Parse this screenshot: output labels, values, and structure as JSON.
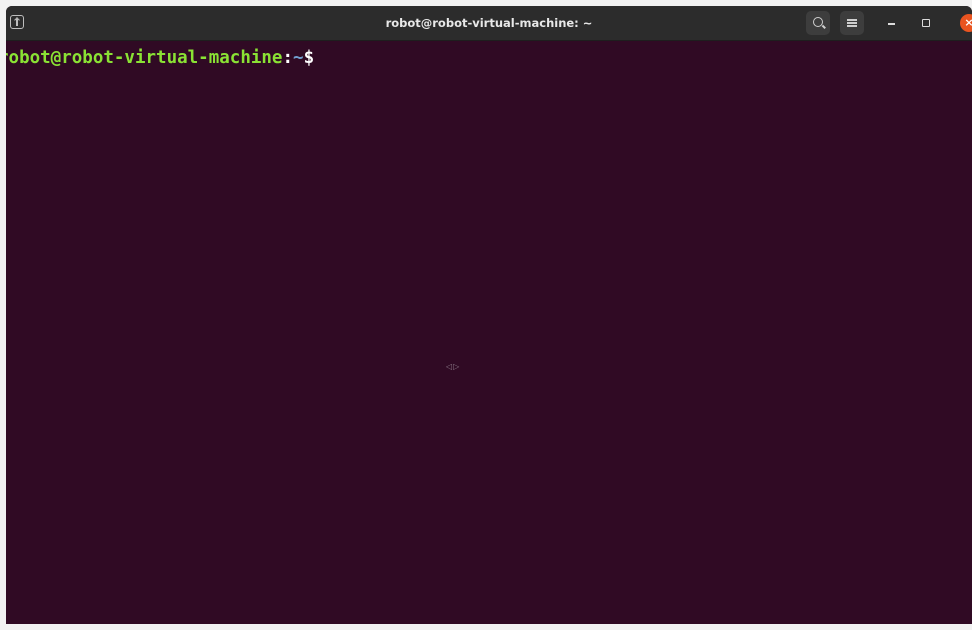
{
  "window": {
    "title": "robot@robot-virtual-machine: ~",
    "colors": {
      "terminal_background": "#300a24",
      "titlebar_background": "#2c2c2c",
      "close_button": "#e95420",
      "prompt_user": "#8ae234",
      "prompt_path": "#729fcf"
    },
    "icons": {
      "new_tab": "new-tab-icon",
      "search": "search-icon",
      "menu": "hamburger-menu-icon",
      "minimize": "minimize-icon",
      "maximize": "maximize-icon",
      "close": "close-icon"
    },
    "close_glyph": "×"
  },
  "terminal": {
    "prompt_user_host": "robot@robot-virtual-machine",
    "prompt_colon": ":",
    "prompt_path": "~",
    "prompt_symbol": "$",
    "resize_hint": "◁▷"
  }
}
